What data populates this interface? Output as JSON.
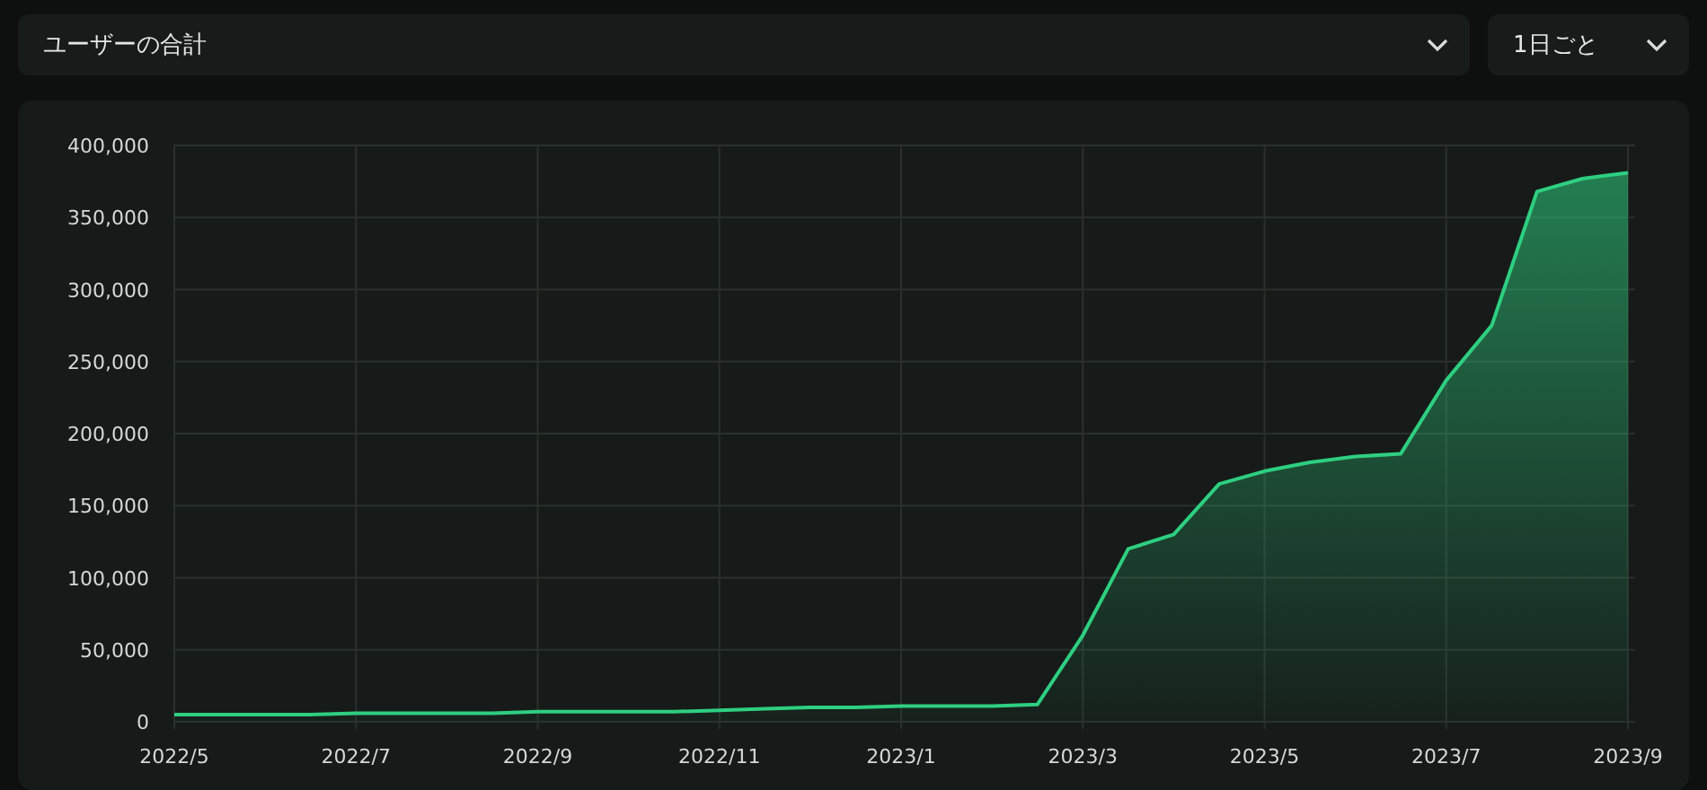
{
  "metric_select": {
    "value": "ユーザーの合計"
  },
  "interval_select": {
    "value": "1日ごと"
  },
  "chart": {
    "chart_data": {
      "type": "area",
      "categories": [
        "2022/5",
        null,
        null,
        null,
        "2022/7",
        null,
        null,
        null,
        "2022/9",
        null,
        null,
        null,
        "2022/11",
        null,
        null,
        null,
        "2023/1",
        null,
        null,
        null,
        "2023/3",
        null,
        null,
        null,
        "2023/5",
        null,
        null,
        null,
        "2023/7",
        null,
        null,
        null,
        "2023/9"
      ],
      "series": [
        {
          "color": "#2ecf80",
          "values": [
            5000,
            5000,
            5000,
            5000,
            6000,
            6000,
            6000,
            6000,
            7000,
            7000,
            7000,
            7000,
            8000,
            9000,
            10000,
            10000,
            11000,
            11000,
            11000,
            12000,
            60000,
            120000,
            130000,
            165000,
            174000,
            180000,
            184000,
            186000,
            237000,
            275000,
            368000,
            377000,
            381000
          ]
        }
      ],
      "ylim": [
        0,
        400000
      ],
      "grid": true,
      "yticks": [
        {
          "value": 0,
          "label": "0"
        },
        {
          "value": 50000,
          "label": "50,000"
        },
        {
          "value": 100000,
          "label": "100,000"
        },
        {
          "value": 150000,
          "label": "150,000"
        },
        {
          "value": 200000,
          "label": "200,000"
        },
        {
          "value": 250000,
          "label": "250,000"
        },
        {
          "value": 300000,
          "label": "300,000"
        },
        {
          "value": 350000,
          "label": "350,000"
        },
        {
          "value": 400000,
          "label": "400,000"
        }
      ]
    }
  }
}
